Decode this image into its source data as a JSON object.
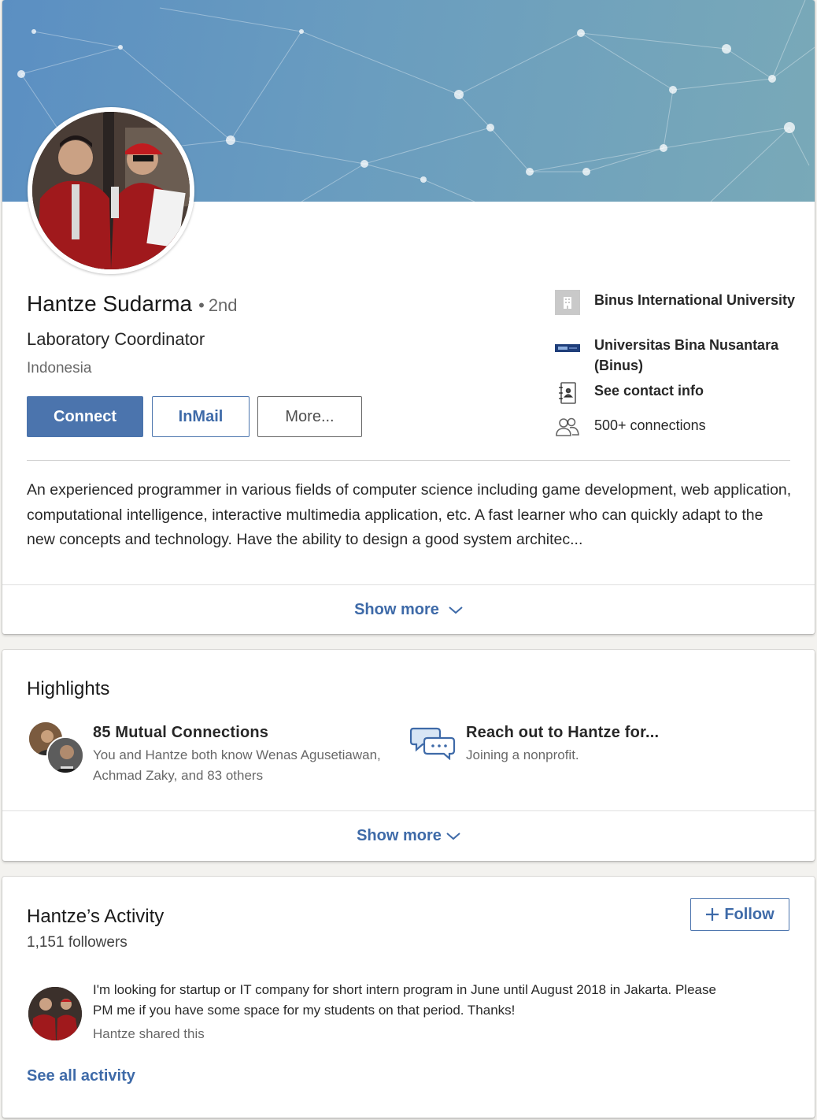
{
  "profile": {
    "name": "Hantze Sudarma",
    "degree": "2nd",
    "degree_separator": "•",
    "headline": "Laboratory Coordinator",
    "location": "Indonesia",
    "actions": {
      "connect_label": "Connect",
      "inmail_label": "InMail",
      "more_label": "More..."
    },
    "side_info": {
      "current_company": "Binus International University",
      "education": "Universitas Bina Nusantara (Binus)",
      "contact_info_label": "See contact info",
      "connections": "500+ connections"
    },
    "summary": "An experienced programmer in various fields of computer science including game development, web application, computational intelligence, interactive multimedia application, etc. A fast learner who can quickly adapt to the new concepts and technology. Have the ability to design a good system architec...",
    "show_more_label": "Show more"
  },
  "highlights": {
    "title": "Highlights",
    "mutual": {
      "title": "85 Mutual Connections",
      "subtitle": "You and Hantze both know Wenas Agusetiawan, Achmad Zaky, and 83 others"
    },
    "reach_out": {
      "title": "Reach out to Hantze for...",
      "subtitle": "Joining a nonprofit."
    },
    "show_more_label": "Show more"
  },
  "activity": {
    "title": "Hantze’s Activity",
    "followers": "1,151 followers",
    "follow_label": "Follow",
    "post": {
      "text": "I'm looking for startup or IT company for short intern program in June until August 2018 in Jakarta. Please PM me if you have some space for my students on that period. Thanks!",
      "meta": "Hantze shared this"
    },
    "see_all_label": "See all activity"
  },
  "colors": {
    "primary": "#4b74ad",
    "link": "#3e6aa8",
    "banner_start": "#5b8fc2",
    "banner_end": "#79a9b8"
  },
  "icons": {
    "company": "building-icon",
    "school": "school-logo-icon",
    "contact": "address-book-icon",
    "connections": "people-icon",
    "reach_out": "chat-bubbles-icon",
    "chevron": "chevron-down-icon",
    "follow": "plus-icon"
  }
}
